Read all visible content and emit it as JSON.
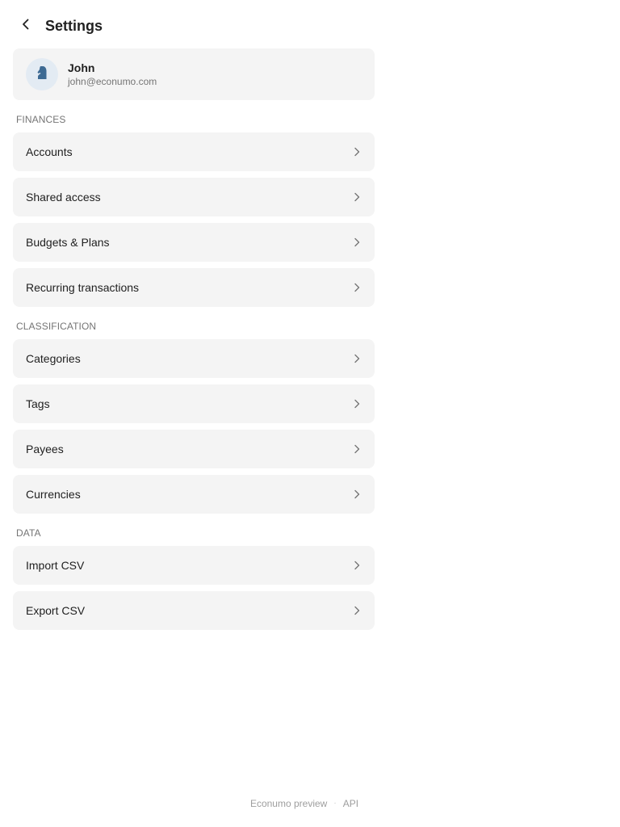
{
  "header": {
    "title": "Settings",
    "back_icon": "chevron-left-icon"
  },
  "profile": {
    "name": "John",
    "email": "john@econumo.com",
    "avatar_icon": "horse-avatar-icon",
    "avatar_color": "#3d6a93"
  },
  "sections": {
    "finances": {
      "label": "FINANCES",
      "items": [
        {
          "label": "Accounts"
        },
        {
          "label": "Shared access"
        },
        {
          "label": "Budgets & Plans"
        },
        {
          "label": "Recurring transactions"
        }
      ]
    },
    "classification": {
      "label": "CLASSIFICATION",
      "items": [
        {
          "label": "Categories"
        },
        {
          "label": "Tags"
        },
        {
          "label": "Payees"
        },
        {
          "label": "Currencies"
        }
      ]
    },
    "data": {
      "label": "DATA",
      "items": [
        {
          "label": "Import CSV"
        },
        {
          "label": "Export CSV"
        }
      ]
    }
  },
  "footer": {
    "preview_label": "Econumo preview",
    "separator": "·",
    "api_label": "API"
  },
  "colors": {
    "card_background": "#f4f4f4",
    "text_primary": "#212121",
    "text_secondary": "#757575"
  }
}
